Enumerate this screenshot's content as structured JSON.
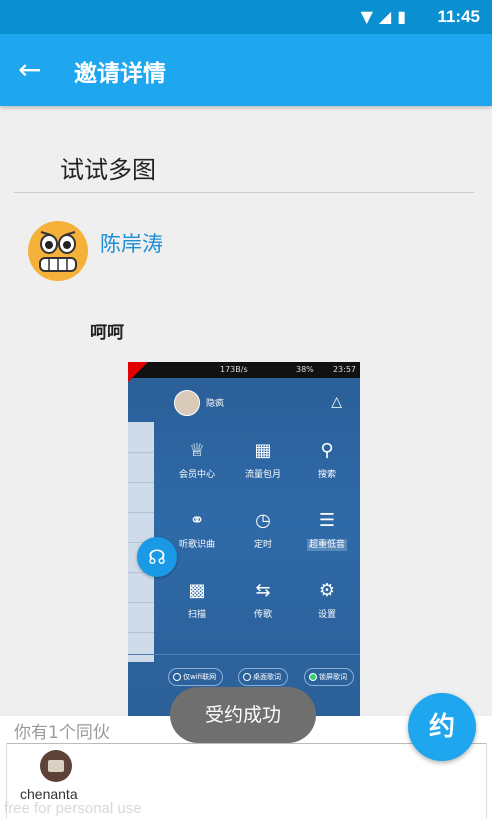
{
  "status_bar": {
    "time": "11:45",
    "icons": [
      "wifi-icon",
      "signal-icon",
      "battery-icon"
    ]
  },
  "app_bar": {
    "title": "邀请详情",
    "back_icon": "arrow-left-icon"
  },
  "post": {
    "title": "试试多图",
    "author": "陈岸涛",
    "content": "呵呵",
    "image": {
      "net_speed": "173B/s",
      "battery": "38%",
      "time": "23:57",
      "user_name": "隐疯",
      "menu": [
        {
          "label": "会员中心",
          "icon": "crown-icon"
        },
        {
          "label": "流量包月",
          "icon": "gift-icon"
        },
        {
          "label": "搜索",
          "icon": "search-icon"
        },
        {
          "label": "听歌识曲",
          "icon": "mic-icon"
        },
        {
          "label": "定时",
          "icon": "timer-icon"
        },
        {
          "label": "超重低音",
          "icon": "equalizer-icon"
        },
        {
          "label": "扫描",
          "icon": "scan-icon"
        },
        {
          "label": "传歌",
          "icon": "transfer-icon"
        },
        {
          "label": "设置",
          "icon": "gear-icon"
        }
      ],
      "pills": [
        "仅wifi联网",
        "桌面歌词",
        "锁屏歌词"
      ]
    }
  },
  "partners": {
    "label": "你有1个同伙",
    "items": [
      {
        "name": "chenanta"
      }
    ]
  },
  "toast": "受约成功",
  "fab_label": "约",
  "watermark": "free for personal use",
  "colors": {
    "primary": "#1ea6ee",
    "status_bar": "#0a90d0"
  }
}
